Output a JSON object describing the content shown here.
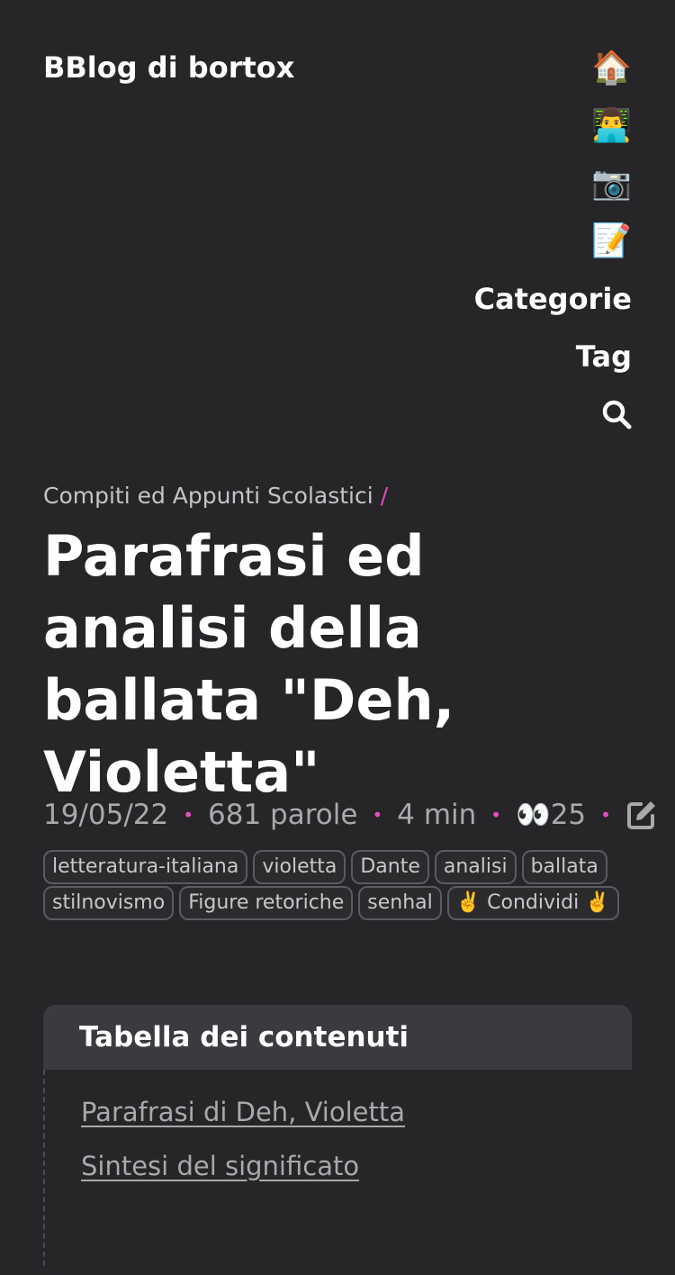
{
  "site": {
    "title": "BBlog di bortox"
  },
  "nav": {
    "icons": [
      "🏠",
      "👨‍💻",
      "📷",
      "📝"
    ],
    "icon_names": [
      "home-icon",
      "developer-icon",
      "camera-icon",
      "memo-icon"
    ],
    "categories": "Categorie",
    "tag": "Tag"
  },
  "post": {
    "breadcrumb": "Compiti ed Appunti Scolastici",
    "breadcrumb_sep": "/",
    "title": "Parafrasi ed analisi della ballata \"Deh, Violetta\"",
    "date": "19/05/22",
    "words": "681 parole",
    "read_time": "4 min",
    "views": "👀25",
    "tags": [
      "letteratura-italiana",
      "violetta",
      "Dante",
      "analisi",
      "ballata",
      "stilnovismo",
      "Figure retoriche",
      "senhal",
      "✌️ Condividi ✌️"
    ]
  },
  "toc": {
    "title": "Tabella dei contenuti",
    "items": [
      "Parafrasi di Deh, Violetta",
      "Sintesi del significato"
    ]
  }
}
